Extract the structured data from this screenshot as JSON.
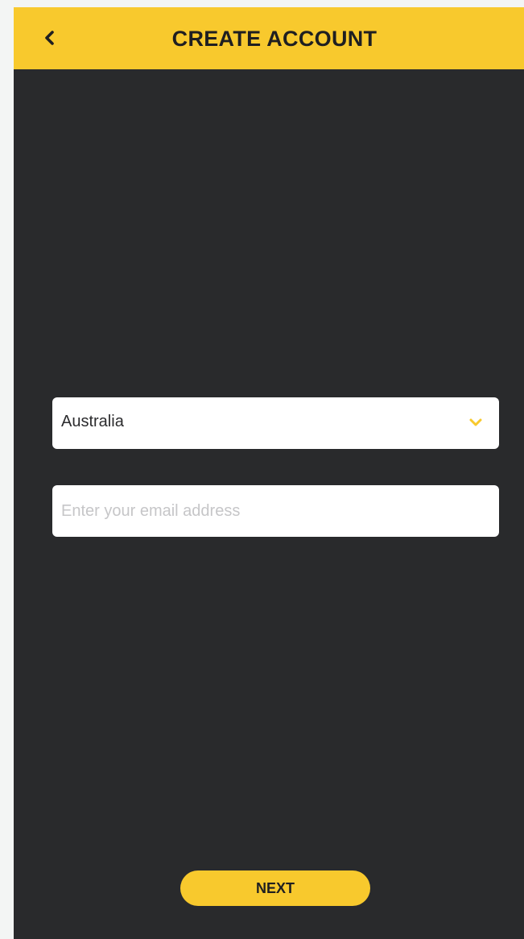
{
  "header": {
    "title": "CREATE ACCOUNT",
    "back_icon": "chevron-left-icon"
  },
  "form": {
    "country": {
      "value": "Australia",
      "icon": "chevron-down-icon"
    },
    "email": {
      "value": "",
      "placeholder": "Enter your email address"
    }
  },
  "footer": {
    "next_label": "NEXT"
  },
  "colors": {
    "accent": "#f8c92d",
    "background": "#292a2c",
    "field": "#ffffff",
    "outer": "#f3f5f4"
  }
}
